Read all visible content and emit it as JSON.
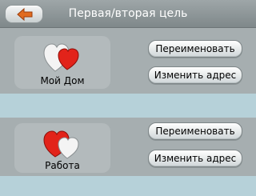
{
  "header": {
    "title": "Первая/вторая цель",
    "back_icon": "back-arrow-icon"
  },
  "targets": [
    {
      "label": "Мой Дом",
      "icon": "hearts-icon",
      "rename_label": "Переименовать",
      "change_address_label": "Изменить адрес"
    },
    {
      "label": "Работа",
      "icon": "hearts-icon",
      "rename_label": "Переименовать",
      "change_address_label": "Изменить адрес"
    }
  ],
  "colors": {
    "header": "#8d9597",
    "panel": "#a6aeb0",
    "separator": "#b6d1d9",
    "heart_red": "#e5231b",
    "back_arrow": "#d9661f"
  }
}
